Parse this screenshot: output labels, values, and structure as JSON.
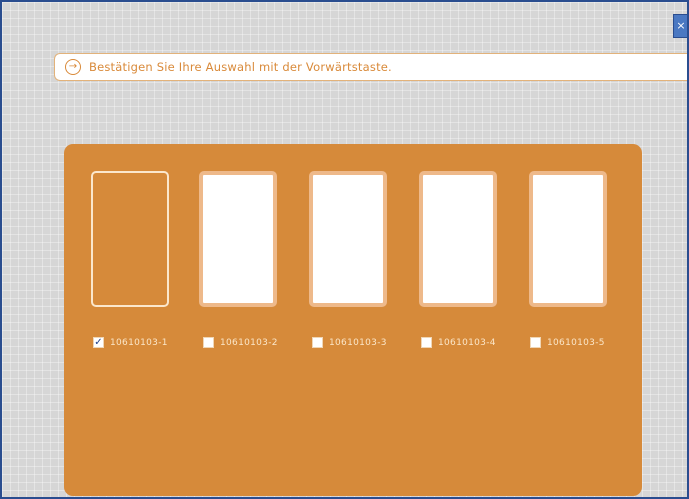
{
  "info": {
    "icon": "arrow-circle-icon",
    "text": "Bestätigen Sie Ihre Auswahl mit der Vorwärtstaste."
  },
  "window": {
    "close_glyph": "×"
  },
  "options": [
    {
      "label": "10610103-1",
      "checked": true
    },
    {
      "label": "10610103-2",
      "checked": false
    },
    {
      "label": "10610103-3",
      "checked": false
    },
    {
      "label": "10610103-4",
      "checked": false
    },
    {
      "label": "10610103-5",
      "checked": false
    }
  ],
  "colors": {
    "accent": "#d68a3a",
    "frame_border": "#2a4d8f",
    "card_border": "#eeb98a",
    "check_mark": "#1f3f88"
  }
}
